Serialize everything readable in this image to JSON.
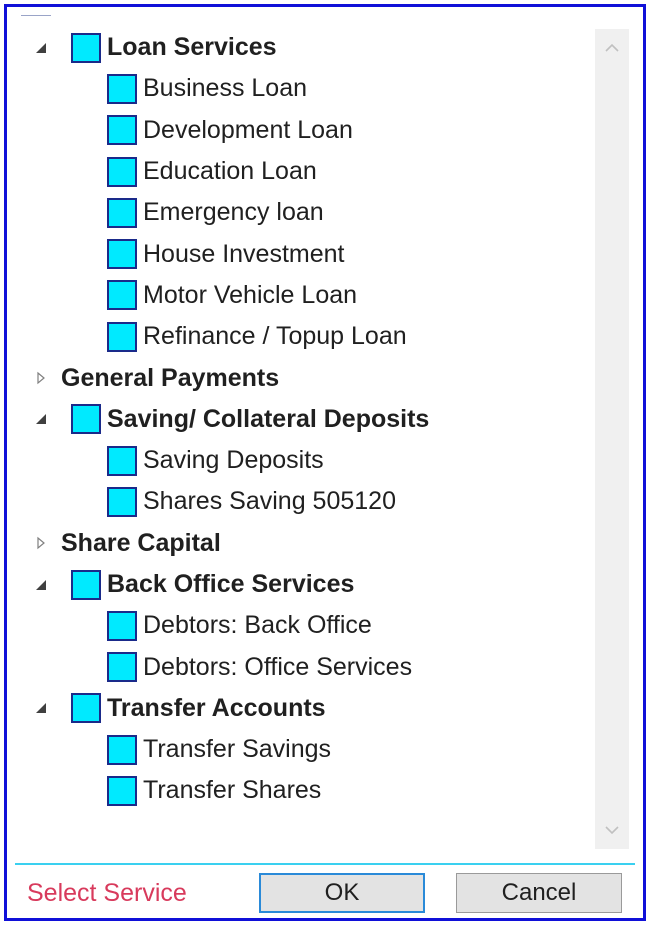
{
  "tree": {
    "groups": [
      {
        "label": "Loan Services",
        "expanded": true,
        "has_checkbox": true,
        "children": [
          "Business Loan",
          "Development Loan",
          "Education Loan",
          "Emergency loan",
          "House Investment",
          "Motor Vehicle Loan",
          "Refinance / Topup Loan"
        ]
      },
      {
        "label": "General Payments",
        "expanded": false,
        "has_checkbox": false,
        "children": []
      },
      {
        "label": "Saving/ Collateral Deposits",
        "expanded": true,
        "has_checkbox": true,
        "children": [
          "Saving Deposits",
          "Shares Saving 505120"
        ]
      },
      {
        "label": "Share Capital",
        "expanded": false,
        "has_checkbox": false,
        "children": []
      },
      {
        "label": "Back Office Services",
        "expanded": true,
        "has_checkbox": true,
        "children": [
          "Debtors: Back Office",
          "Debtors: Office Services"
        ]
      },
      {
        "label": "Transfer Accounts",
        "expanded": true,
        "has_checkbox": true,
        "children": [
          "Transfer Savings",
          "Transfer Shares"
        ]
      }
    ]
  },
  "footer": {
    "status_text": "Select Service",
    "ok_label": "OK",
    "cancel_label": "Cancel"
  },
  "colors": {
    "checkbox_fill": "#00eaff",
    "frame_border": "#1010d8",
    "status_text": "#d83a5c",
    "ok_border": "#2a8ad8"
  },
  "icons": {
    "expanded": "expanded-triangle-icon",
    "collapsed": "collapsed-triangle-icon",
    "scroll_up": "chevron-up-icon",
    "scroll_down": "chevron-down-icon"
  }
}
